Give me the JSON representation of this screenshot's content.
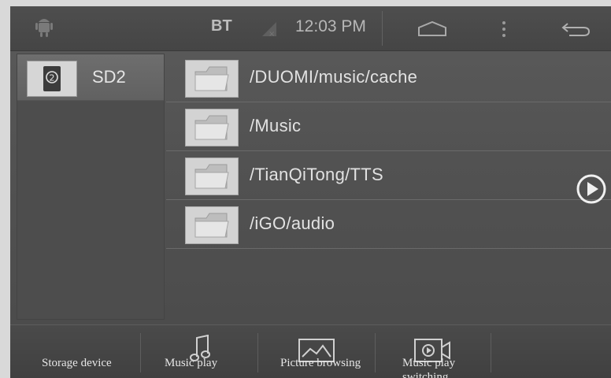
{
  "status_bar": {
    "bt_label": "BT",
    "time": "12:03 PM",
    "icons": [
      "android-icon",
      "signal-icon",
      "home-icon",
      "menu-icon",
      "back-icon"
    ]
  },
  "storage": {
    "device_label": "SD2",
    "device_badge": "2"
  },
  "folders": [
    {
      "path": "/DUOMI/music/cache"
    },
    {
      "path": "/Music"
    },
    {
      "path": "/TianQiTong/TTS"
    },
    {
      "path": "/iGO/audio"
    }
  ],
  "bottom_nav": {
    "storage_device": "Storage device",
    "music_play": "Music play",
    "picture_browsing": "Picture browsing",
    "music_play_switching_1": "Music play",
    "music_play_switching_2": "switching"
  },
  "colors": {
    "background": "#525252",
    "text": "#e2e2e2",
    "selected_device": "#6e6e6e"
  }
}
